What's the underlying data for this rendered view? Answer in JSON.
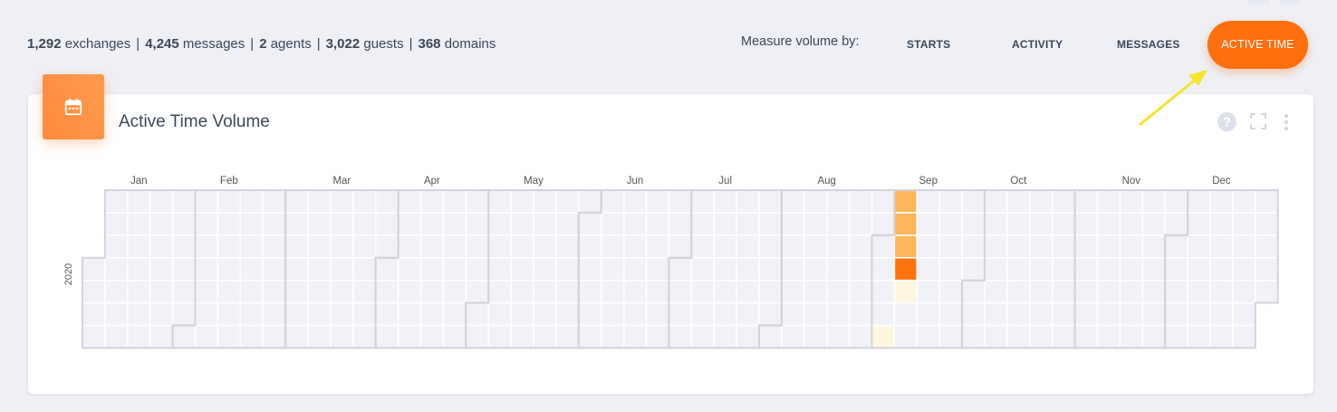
{
  "stats": {
    "exchanges_count": "1,292",
    "exchanges_label": "exchanges",
    "messages_count": "4,245",
    "messages_label": "messages",
    "agents_count": "2",
    "agents_label": "agents",
    "guests_count": "3,022",
    "guests_label": "guests",
    "domains_count": "368",
    "domains_label": "domains"
  },
  "measure": {
    "label": "Measure volume by:",
    "options": [
      "STARTS",
      "ACTIVITY",
      "MESSAGES",
      "ACTIVE TIME"
    ],
    "selected": "ACTIVE TIME"
  },
  "card": {
    "title": "Active Time Volume",
    "icon": "calendar-icon",
    "tools": [
      "help-icon",
      "fullscreen-icon",
      "more-vert-icon"
    ]
  },
  "colors": {
    "accent": "#ff6f0e",
    "empty_cell": "#f1f2f7",
    "level_low": "#fff6e0",
    "level_mid": "#fdb65b",
    "level_high": "#fe720d",
    "annotation_arrow": "#f5e52d"
  },
  "chart_data": {
    "type": "heatmap",
    "year": "2020",
    "months": [
      "Jan",
      "Feb",
      "Mar",
      "Apr",
      "May",
      "Jun",
      "Jul",
      "Aug",
      "Sep",
      "Oct",
      "Nov",
      "Dec"
    ],
    "active_days": [
      {
        "date": "2020-09-05",
        "level": "low"
      },
      {
        "date": "2020-09-06",
        "level": "mid"
      },
      {
        "date": "2020-09-07",
        "level": "mid"
      },
      {
        "date": "2020-09-08",
        "level": "mid"
      },
      {
        "date": "2020-09-09",
        "level": "high"
      },
      {
        "date": "2020-09-10",
        "level": "low"
      }
    ]
  }
}
